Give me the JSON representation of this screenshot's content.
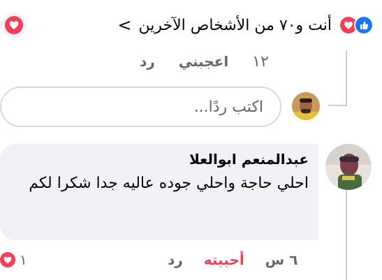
{
  "reactions_summary": {
    "text": "أنت و٧٠ من الأشخاص الآخرين",
    "chevron": "<",
    "icons": [
      "like-icon",
      "love-icon"
    ],
    "colors": {
      "like": "#1877f2",
      "love": "#f33e58"
    }
  },
  "reply_thread": {
    "like_count": "١٢",
    "like_label": "اعجبني",
    "reply_label": "رد"
  },
  "reply_box": {
    "placeholder": "اكتب ردًا..."
  },
  "comment": {
    "author": "عبدالمنعم ابوالعلا",
    "text": "احلي حاجة واحلي جوده عاليه جدا شكرا لكم",
    "time": "٦ س",
    "loved_label": "أحببته",
    "reply_label": "رد",
    "reaction_count": "١",
    "reaction_icon": "love-icon"
  },
  "colors": {
    "text_primary": "#050505",
    "text_secondary": "#65676b",
    "bubble_bg": "#f0f2f5",
    "love": "#f33e58",
    "like": "#1877f2"
  }
}
